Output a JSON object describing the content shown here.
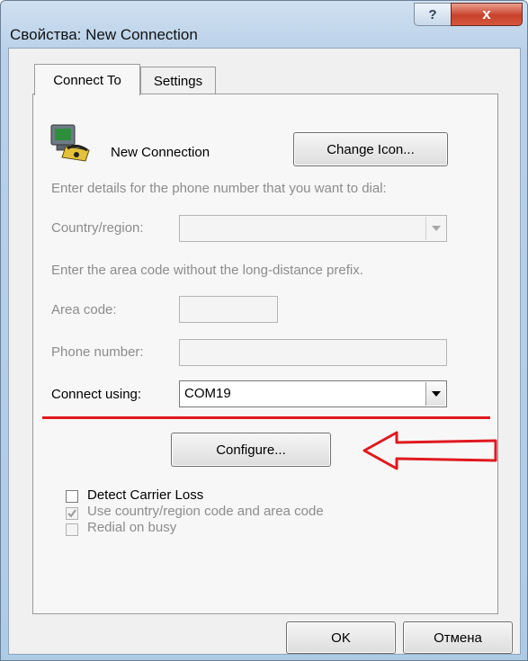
{
  "window": {
    "title": "Свойства: New Connection",
    "help_glyph": "?",
    "close_glyph": "x"
  },
  "tabs": [
    {
      "label": "Connect To",
      "active": true
    },
    {
      "label": "Settings",
      "active": false
    }
  ],
  "connection": {
    "name": "New Connection",
    "change_icon_label": "Change Icon...",
    "icon": "phone-computer-icon"
  },
  "phone_section": {
    "instructions": "Enter details for the phone number that you want to dial:",
    "country_label": "Country/region:",
    "country_value": "",
    "area_instructions": "Enter the area code without the long-distance prefix.",
    "area_label": "Area code:",
    "area_value": "",
    "phone_label": "Phone number:",
    "phone_value": ""
  },
  "connect_using": {
    "label": "Connect using:",
    "value": "COM19"
  },
  "configure_label": "Configure...",
  "options": [
    {
      "label": "Detect Carrier Loss",
      "checked": false,
      "enabled": true
    },
    {
      "label": "Use country/region code and area code",
      "checked": true,
      "enabled": false
    },
    {
      "label": "Redial on busy",
      "checked": false,
      "enabled": false
    }
  ],
  "footer": {
    "ok_label": "OK",
    "cancel_label": "Отмена"
  },
  "annotation": {
    "color": "#e0191f"
  }
}
